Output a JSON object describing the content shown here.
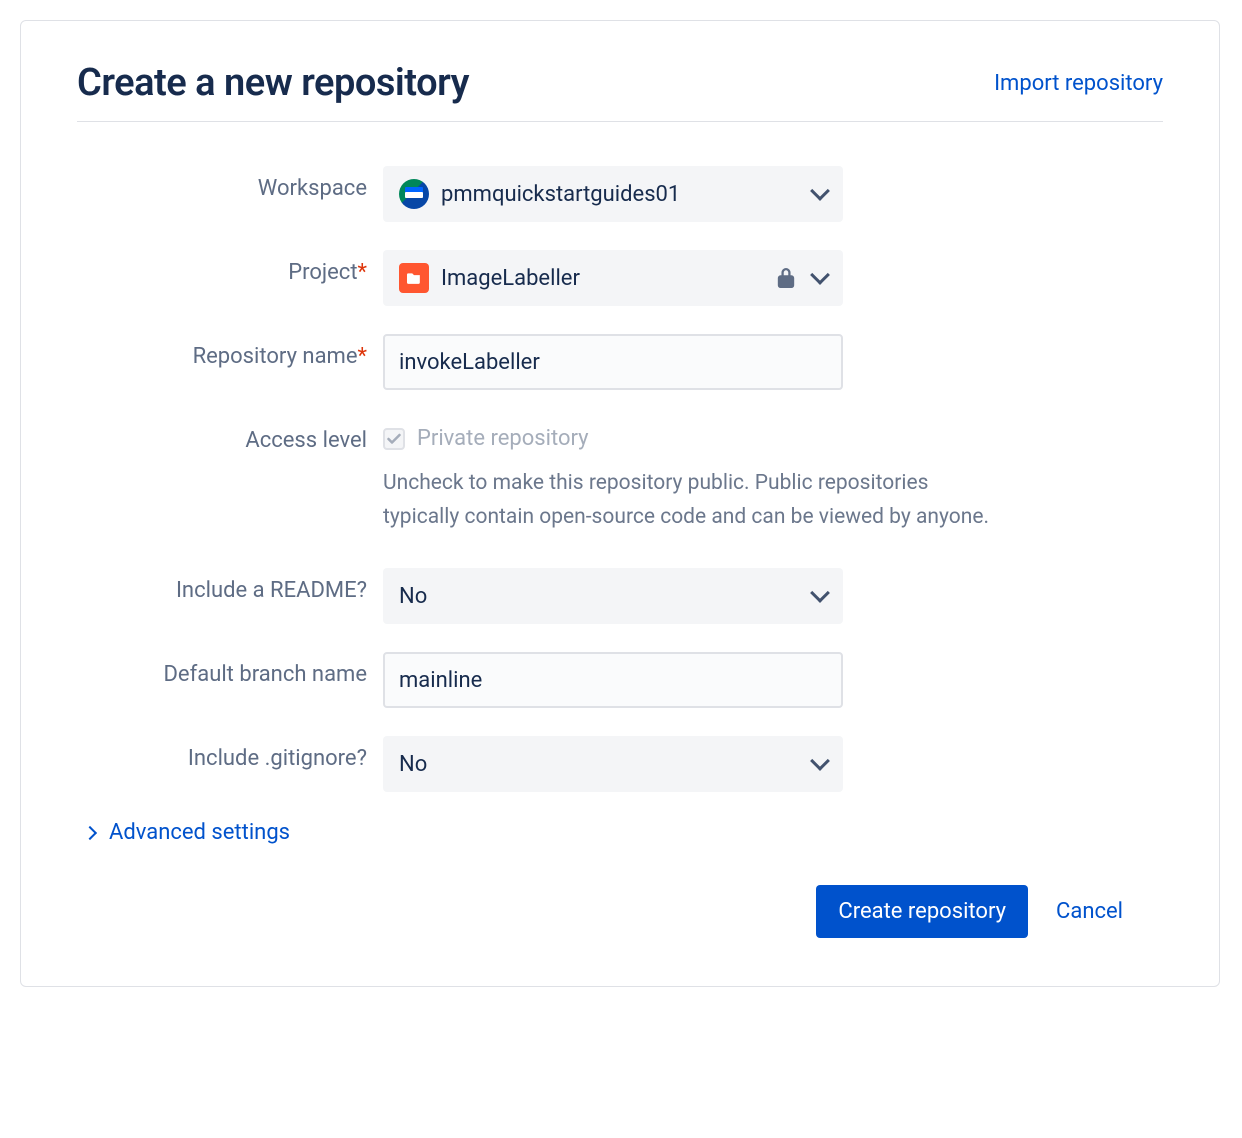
{
  "header": {
    "title": "Create a new repository",
    "import_link": "Import repository"
  },
  "form": {
    "workspace": {
      "label": "Workspace",
      "value": "pmmquickstartguides01"
    },
    "project": {
      "label": "Project",
      "required": true,
      "value": "ImageLabeller"
    },
    "repo_name": {
      "label": "Repository name",
      "required": true,
      "value": "invokeLabeller"
    },
    "access": {
      "label": "Access level",
      "checkbox_label": "Private repository",
      "checked": true,
      "help": "Uncheck to make this repository public. Public repositories typically contain open-source code and can be viewed by anyone."
    },
    "readme": {
      "label": "Include a README?",
      "value": "No"
    },
    "default_branch": {
      "label": "Default branch name",
      "value": "mainline"
    },
    "gitignore": {
      "label": "Include .gitignore?",
      "value": "No"
    },
    "advanced": {
      "label": "Advanced settings"
    }
  },
  "footer": {
    "submit": "Create repository",
    "cancel": "Cancel"
  }
}
